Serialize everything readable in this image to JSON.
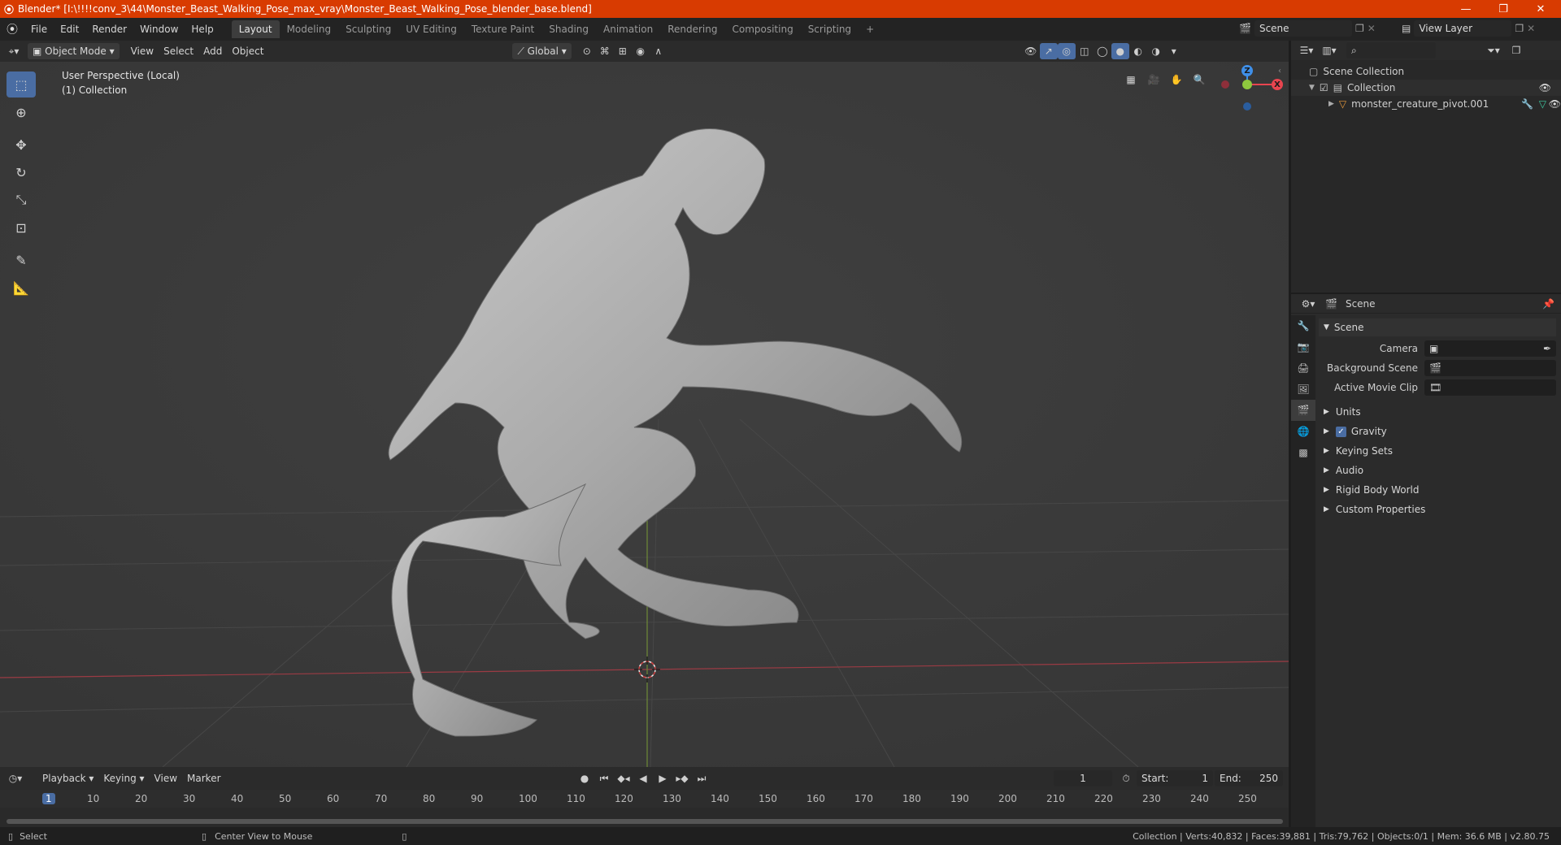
{
  "titlebar": {
    "title": "Blender* [I:\\!!!!conv_3\\44\\Monster_Beast_Walking_Pose_max_vray\\Monster_Beast_Walking_Pose_blender_base.blend]",
    "minimize": "—",
    "maximize": "❐",
    "close": "✕"
  },
  "menubar": {
    "menus": [
      "File",
      "Edit",
      "Render",
      "Window",
      "Help"
    ],
    "workspaces": [
      "Layout",
      "Modeling",
      "Sculpting",
      "UV Editing",
      "Texture Paint",
      "Shading",
      "Animation",
      "Rendering",
      "Compositing",
      "Scripting"
    ],
    "active_workspace": "Layout",
    "add_tab": "+",
    "scene_name": "Scene",
    "view_layer": "View Layer"
  },
  "viewport_header": {
    "mode": "Object Mode",
    "menus": [
      "View",
      "Select",
      "Add",
      "Object"
    ],
    "orientation": "Global"
  },
  "viewport": {
    "perspective_label": "User Perspective (Local)",
    "collection_label": "(1) Collection",
    "gizmo": {
      "x": "X",
      "y": "Y",
      "z": "Z"
    },
    "colors": {
      "x_axis": "#e8454f",
      "y_axis": "#8ec83e",
      "z_axis": "#3f8fe8",
      "background": "#3c3c3c",
      "active_tool": "#4a6da3"
    }
  },
  "outliner": {
    "search_placeholder": "",
    "root": "Scene Collection",
    "collection": "Collection",
    "object": "monster_creature_pivot.001"
  },
  "properties": {
    "context": "Scene",
    "section": "Scene",
    "camera_label": "Camera",
    "background_scene_label": "Background Scene",
    "active_movie_clip_label": "Active Movie Clip",
    "subpanels": [
      "Units",
      "Gravity",
      "Keying Sets",
      "Audio",
      "Rigid Body World",
      "Custom Properties"
    ],
    "gravity_enabled": true
  },
  "timeline": {
    "menus": [
      "Playback",
      "Keying",
      "View",
      "Marker"
    ],
    "current_frame": "1",
    "start_label": "Start:",
    "start": "1",
    "end_label": "End:",
    "end": "250",
    "ruler": [
      "1",
      "10",
      "20",
      "30",
      "40",
      "50",
      "60",
      "70",
      "80",
      "90",
      "100",
      "110",
      "120",
      "130",
      "140",
      "150",
      "160",
      "170",
      "180",
      "190",
      "200",
      "210",
      "220",
      "230",
      "240",
      "250"
    ]
  },
  "statusbar": {
    "select": "Select",
    "center_view": "Center View to Mouse",
    "stats": "Collection | Verts:40,832 | Faces:39,881 | Tris:79,762 | Objects:0/1 | Mem: 36.6 MB | v2.80.75"
  }
}
